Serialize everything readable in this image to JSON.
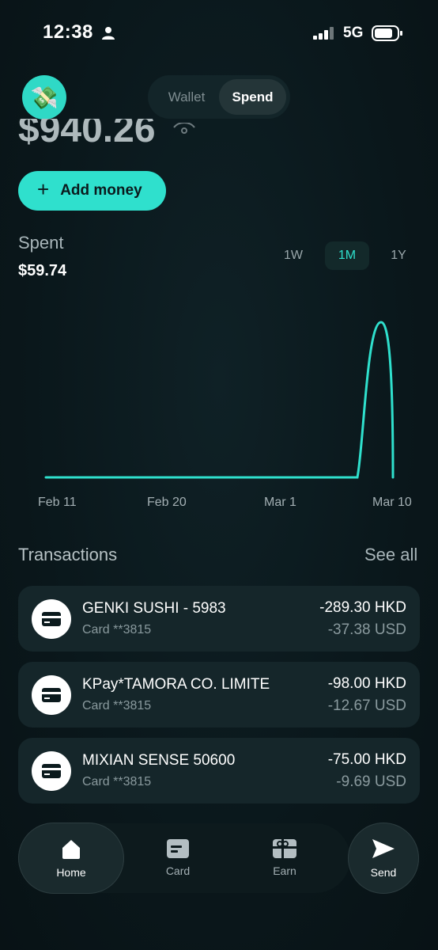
{
  "status_bar": {
    "time": "12:38",
    "network": "5G"
  },
  "header": {
    "avatar_icon": "money-bag-icon",
    "tabs": [
      {
        "label": "Wallet",
        "active": false
      },
      {
        "label": "Spend",
        "active": true
      }
    ]
  },
  "balance": {
    "amount": "$940.26"
  },
  "add_money": {
    "label": "Add money"
  },
  "spent": {
    "label": "Spent",
    "value": "$59.74",
    "ranges": [
      {
        "label": "1W"
      },
      {
        "label": "1M",
        "active": true
      },
      {
        "label": "1Y"
      }
    ]
  },
  "chart_data": {
    "type": "line",
    "x": [
      "Feb 11",
      "Feb 20",
      "Mar 1",
      "Mar 10"
    ],
    "x_tick_labels": [
      "Feb 11",
      "Feb 20",
      "Mar 1",
      "Mar 10"
    ],
    "series": [
      {
        "values": [
          0,
          0,
          0,
          59.74
        ]
      }
    ],
    "color": "#2fe0cd",
    "grid": false
  },
  "transactions": {
    "title": "Transactions",
    "see_all": "See all",
    "items": [
      {
        "name": "GENKI SUSHI - 5983",
        "card": "Card **3815",
        "amount": "-289.30 HKD",
        "usd": "-37.38 USD"
      },
      {
        "name": "KPay*TAMORA CO. LIMITE",
        "card": "Card **3815",
        "amount": "-98.00 HKD",
        "usd": "-12.67 USD"
      },
      {
        "name": "MIXIAN SENSE 50600",
        "card": "Card **3815",
        "amount": "-75.00 HKD",
        "usd": "-9.69 USD"
      }
    ]
  },
  "nav": {
    "home": "Home",
    "card": "Card",
    "earn": "Earn",
    "send": "Send"
  },
  "colors": {
    "accent": "#2fe0cd",
    "background": "#0a171b",
    "card": "#15262a"
  }
}
